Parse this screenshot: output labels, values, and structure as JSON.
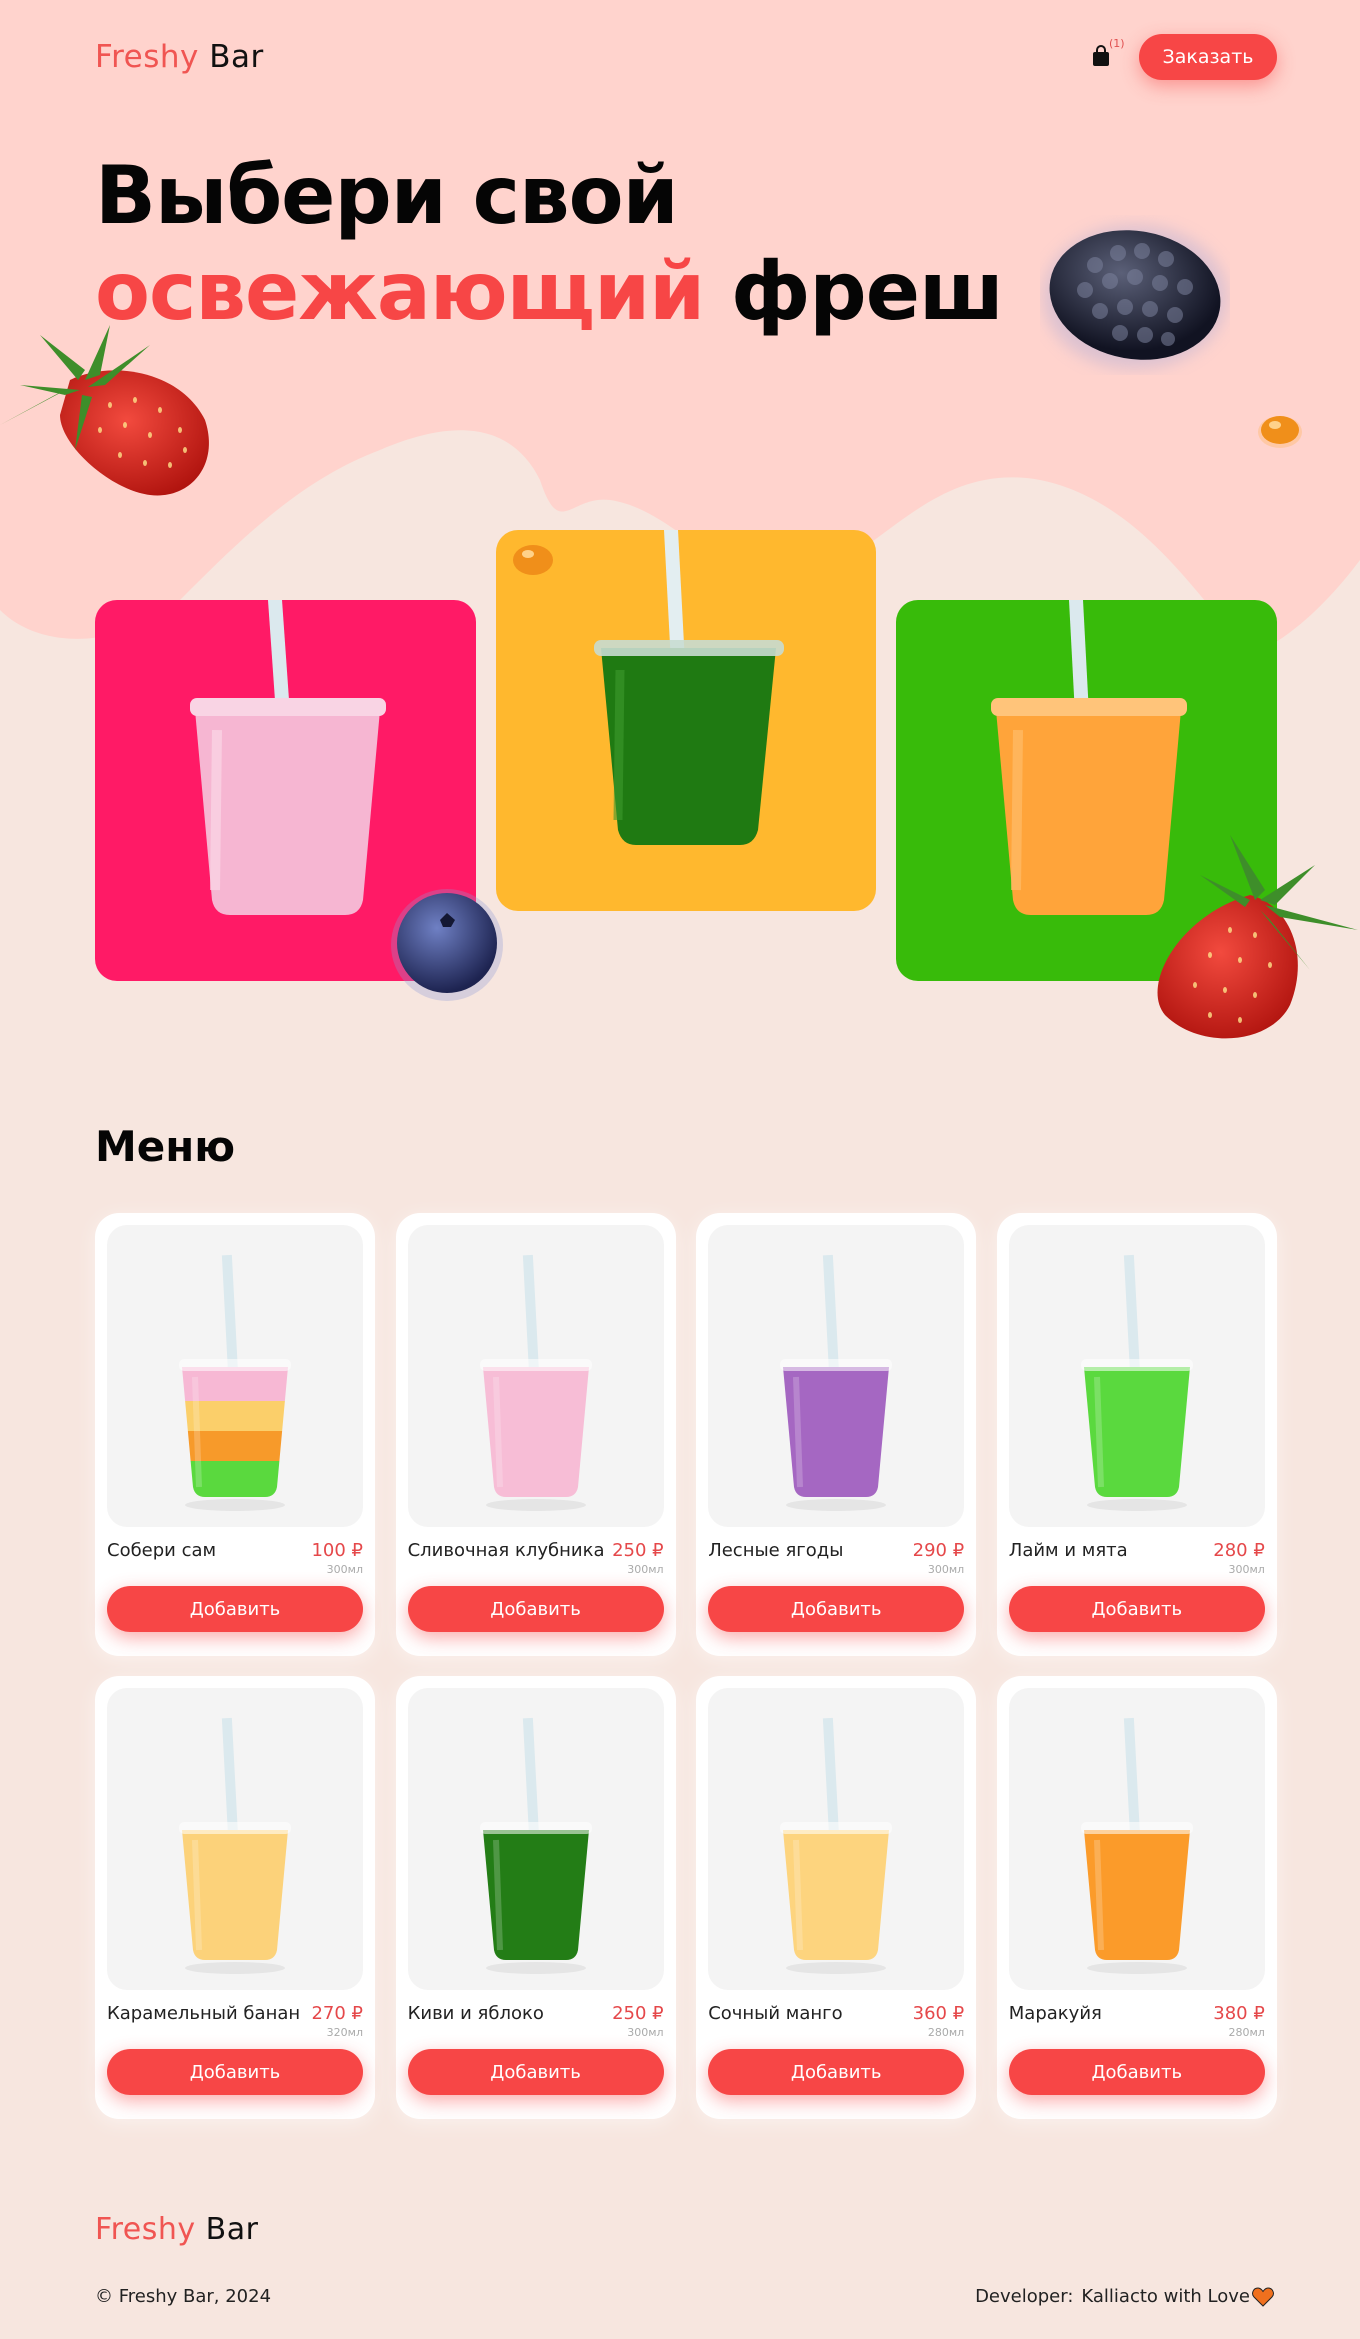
{
  "header": {
    "logo_part1": "Freshy",
    "logo_part2": "Bar",
    "cart_count": "(1)",
    "order_button": "Заказать"
  },
  "hero": {
    "title_line1": "Выбери свой",
    "title_accent": "освежающий",
    "title_end": "фреш"
  },
  "hero_cards": [
    {
      "color": "#ff1a66",
      "drink_color": "#f6b6d2"
    },
    {
      "color": "#ffb82e",
      "drink_color": "#1f7a12"
    },
    {
      "color": "#38bb0a",
      "drink_color": "#ffa43a"
    }
  ],
  "menu": {
    "title": "Меню",
    "items": [
      {
        "name": "Собери сам",
        "price": "100 ₽",
        "volume": "300мл",
        "button": "Добавить",
        "drink": "layered"
      },
      {
        "name": "Сливочная клубника",
        "price": "250 ₽",
        "volume": "300мл",
        "button": "Добавить",
        "drink": "#f7bdd6"
      },
      {
        "name": "Лесные ягоды",
        "price": "290 ₽",
        "volume": "300мл",
        "button": "Добавить",
        "drink": "#a567c2"
      },
      {
        "name": "Лайм и мята",
        "price": "280 ₽",
        "volume": "300мл",
        "button": "Добавить",
        "drink": "#5ad93e"
      },
      {
        "name": "Карамельный банан",
        "price": "270 ₽",
        "volume": "320мл",
        "button": "Добавить",
        "drink": "#fcd27a"
      },
      {
        "name": "Киви и яблоко",
        "price": "250 ₽",
        "volume": "300мл",
        "button": "Добавить",
        "drink": "#237d16"
      },
      {
        "name": "Сочный манго",
        "price": "360 ₽",
        "volume": "280мл",
        "button": "Добавить",
        "drink": "#fdd47e"
      },
      {
        "name": "Маракуйя",
        "price": "380 ₽",
        "volume": "280мл",
        "button": "Добавить",
        "drink": "#fb9b2a"
      }
    ]
  },
  "footer": {
    "logo_part1": "Freshy",
    "logo_part2": "Bar",
    "copyright": "© Freshy Bar, 2024",
    "developer_label": "Developer:",
    "developer_name": "Kalliacto with Love"
  },
  "colors": {
    "accent": "#f74646",
    "background": "#f7e6df",
    "hero_background": "#ffd3cd"
  }
}
